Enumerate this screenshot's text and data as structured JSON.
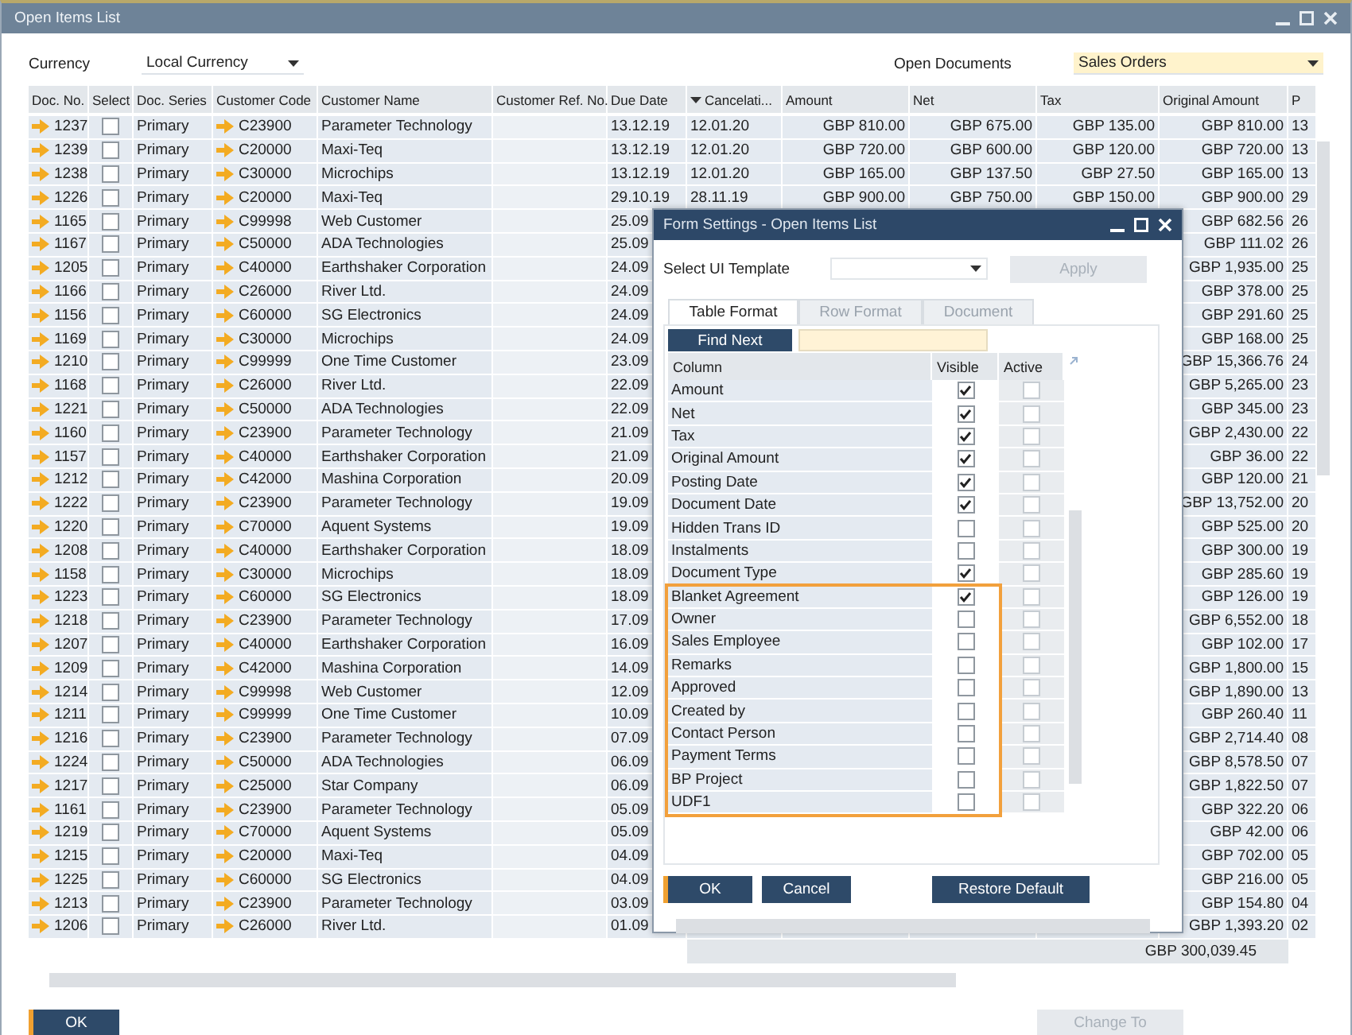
{
  "window": {
    "title": "Open Items List"
  },
  "filters": [
    {
      "label": "Currency",
      "value": "Local Currency",
      "highlighted": false
    },
    {
      "label": "Open Documents",
      "value": "Sales Orders",
      "highlighted": true
    }
  ],
  "table": {
    "columns": [
      {
        "label": "Doc. No.",
        "sorted": false
      },
      {
        "label": "Select",
        "sorted": false
      },
      {
        "label": "Doc. Series",
        "sorted": false
      },
      {
        "label": "Customer Code",
        "sorted": false
      },
      {
        "label": "Customer Name",
        "sorted": false
      },
      {
        "label": "Customer Ref. No.",
        "sorted": false
      },
      {
        "label": "Due Date",
        "sorted": false
      },
      {
        "label": "Cancelati...",
        "sorted": true
      },
      {
        "label": "Amount",
        "sorted": false
      },
      {
        "label": "Net",
        "sorted": false
      },
      {
        "label": "Tax",
        "sorted": false
      },
      {
        "label": "Original Amount",
        "sorted": false
      },
      {
        "label": "P",
        "sorted": false
      }
    ],
    "rows": [
      {
        "doc_no": "1237",
        "checked": false,
        "series": "Primary",
        "code": "C23900",
        "name": "Parameter Technology",
        "due_date": "13.12.19",
        "cancelation": "12.01.20",
        "amount": "GBP 810.00",
        "net": "GBP 675.00",
        "tax": "GBP 135.00",
        "original_amount": "GBP 810.00",
        "column_13": "13"
      },
      {
        "doc_no": "1239",
        "checked": false,
        "series": "Primary",
        "code": "C20000",
        "name": "Maxi-Teq",
        "due_date": "13.12.19",
        "cancelation": "12.01.20",
        "amount": "GBP 720.00",
        "net": "GBP 600.00",
        "tax": "GBP 120.00",
        "original_amount": "GBP 720.00",
        "column_13": "13"
      },
      {
        "doc_no": "1238",
        "checked": false,
        "series": "Primary",
        "code": "C30000",
        "name": "Microchips",
        "due_date": "13.12.19",
        "cancelation": "12.01.20",
        "amount": "GBP 165.00",
        "net": "GBP 137.50",
        "tax": "GBP 27.50",
        "original_amount": "GBP 165.00",
        "column_13": "13"
      },
      {
        "doc_no": "1226",
        "checked": false,
        "series": "Primary",
        "code": "C20000",
        "name": "Maxi-Teq",
        "due_date": "29.10.19",
        "cancelation": "28.11.19",
        "amount": "GBP 900.00",
        "net": "GBP 750.00",
        "tax": "GBP 150.00",
        "original_amount": "GBP 900.00",
        "column_13": "29"
      },
      {
        "doc_no": "1165",
        "checked": false,
        "series": "Primary",
        "code": "C99998",
        "name": "Web Customer",
        "due_date": "25.09",
        "original_amount": "GBP 682.56",
        "column_13": "26"
      },
      {
        "doc_no": "1167",
        "checked": false,
        "series": "Primary",
        "code": "C50000",
        "name": "ADA Technologies",
        "due_date": "25.09",
        "original_amount": "GBP 111.02",
        "column_13": "26"
      },
      {
        "doc_no": "1205",
        "checked": false,
        "series": "Primary",
        "code": "C40000",
        "name": "Earthshaker Corporation",
        "due_date": "24.09",
        "original_amount": "GBP 1,935.00",
        "column_13": "25"
      },
      {
        "doc_no": "1166",
        "checked": false,
        "series": "Primary",
        "code": "C26000",
        "name": "River Ltd.",
        "due_date": "24.09",
        "original_amount": "GBP 378.00",
        "column_13": "25"
      },
      {
        "doc_no": "1156",
        "checked": false,
        "series": "Primary",
        "code": "C60000",
        "name": "SG Electronics",
        "due_date": "24.09",
        "original_amount": "GBP 291.60",
        "column_13": "25"
      },
      {
        "doc_no": "1169",
        "checked": false,
        "series": "Primary",
        "code": "C30000",
        "name": "Microchips",
        "due_date": "24.09",
        "original_amount": "GBP 168.00",
        "column_13": "25"
      },
      {
        "doc_no": "1210",
        "checked": false,
        "series": "Primary",
        "code": "C99999",
        "name": "One Time Customer",
        "due_date": "23.09",
        "original_amount": "GBP 15,366.76",
        "column_13": "24"
      },
      {
        "doc_no": "1168",
        "checked": false,
        "series": "Primary",
        "code": "C26000",
        "name": "River Ltd.",
        "due_date": "22.09",
        "original_amount": "GBP 5,265.00",
        "column_13": "23"
      },
      {
        "doc_no": "1221",
        "checked": false,
        "series": "Primary",
        "code": "C50000",
        "name": "ADA Technologies",
        "due_date": "22.09",
        "original_amount": "GBP 345.00",
        "column_13": "23"
      },
      {
        "doc_no": "1160",
        "checked": false,
        "series": "Primary",
        "code": "C23900",
        "name": "Parameter Technology",
        "due_date": "21.09",
        "original_amount": "GBP 2,430.00",
        "column_13": "22"
      },
      {
        "doc_no": "1157",
        "checked": false,
        "series": "Primary",
        "code": "C40000",
        "name": "Earthshaker Corporation",
        "due_date": "21.09",
        "original_amount": "GBP 36.00",
        "column_13": "22"
      },
      {
        "doc_no": "1212",
        "checked": false,
        "series": "Primary",
        "code": "C42000",
        "name": "Mashina Corporation",
        "due_date": "20.09",
        "original_amount": "GBP 120.00",
        "column_13": "21"
      },
      {
        "doc_no": "1222",
        "checked": false,
        "series": "Primary",
        "code": "C23900",
        "name": "Parameter Technology",
        "due_date": "19.09",
        "original_amount": "GBP 13,752.00",
        "column_13": "20"
      },
      {
        "doc_no": "1220",
        "checked": false,
        "series": "Primary",
        "code": "C70000",
        "name": "Aquent Systems",
        "due_date": "19.09",
        "original_amount": "GBP 525.00",
        "column_13": "20"
      },
      {
        "doc_no": "1208",
        "checked": false,
        "series": "Primary",
        "code": "C40000",
        "name": "Earthshaker Corporation",
        "due_date": "18.09",
        "original_amount": "GBP 300.00",
        "column_13": "19"
      },
      {
        "doc_no": "1158",
        "checked": false,
        "series": "Primary",
        "code": "C30000",
        "name": "Microchips",
        "due_date": "18.09",
        "original_amount": "GBP 285.60",
        "column_13": "19"
      },
      {
        "doc_no": "1223",
        "checked": false,
        "series": "Primary",
        "code": "C60000",
        "name": "SG Electronics",
        "due_date": "18.09",
        "original_amount": "GBP 126.00",
        "column_13": "19"
      },
      {
        "doc_no": "1218",
        "checked": false,
        "series": "Primary",
        "code": "C23900",
        "name": "Parameter Technology",
        "due_date": "17.09",
        "original_amount": "GBP 6,552.00",
        "column_13": "18"
      },
      {
        "doc_no": "1207",
        "checked": false,
        "series": "Primary",
        "code": "C40000",
        "name": "Earthshaker Corporation",
        "due_date": "16.09",
        "original_amount": "GBP 102.00",
        "column_13": "17"
      },
      {
        "doc_no": "1209",
        "checked": false,
        "series": "Primary",
        "code": "C42000",
        "name": "Mashina Corporation",
        "due_date": "14.09",
        "original_amount": "GBP 1,800.00",
        "column_13": "15"
      },
      {
        "doc_no": "1214",
        "checked": false,
        "series": "Primary",
        "code": "C99998",
        "name": "Web Customer",
        "due_date": "12.09",
        "original_amount": "GBP 1,890.00",
        "column_13": "13"
      },
      {
        "doc_no": "1211",
        "checked": false,
        "series": "Primary",
        "code": "C99999",
        "name": "One Time Customer",
        "due_date": "10.09",
        "original_amount": "GBP 260.40",
        "column_13": "11"
      },
      {
        "doc_no": "1216",
        "checked": false,
        "series": "Primary",
        "code": "C23900",
        "name": "Parameter Technology",
        "due_date": "07.09",
        "original_amount": "GBP 2,714.40",
        "column_13": "08"
      },
      {
        "doc_no": "1224",
        "checked": false,
        "series": "Primary",
        "code": "C50000",
        "name": "ADA Technologies",
        "due_date": "06.09",
        "original_amount": "GBP 8,578.50",
        "column_13": "07"
      },
      {
        "doc_no": "1217",
        "checked": false,
        "series": "Primary",
        "code": "C25000",
        "name": "Star Company",
        "due_date": "06.09",
        "original_amount": "GBP 1,822.50",
        "column_13": "07"
      },
      {
        "doc_no": "1161",
        "checked": false,
        "series": "Primary",
        "code": "C23900",
        "name": "Parameter Technology",
        "due_date": "05.09",
        "original_amount": "GBP 322.20",
        "column_13": "06"
      },
      {
        "doc_no": "1219",
        "checked": false,
        "series": "Primary",
        "code": "C70000",
        "name": "Aquent Systems",
        "due_date": "05.09",
        "original_amount": "GBP 42.00",
        "column_13": "06"
      },
      {
        "doc_no": "1215",
        "checked": false,
        "series": "Primary",
        "code": "C20000",
        "name": "Maxi-Teq",
        "due_date": "04.09",
        "original_amount": "GBP 702.00",
        "column_13": "05"
      },
      {
        "doc_no": "1225",
        "checked": false,
        "series": "Primary",
        "code": "C60000",
        "name": "SG Electronics",
        "due_date": "04.09",
        "original_amount": "GBP 216.00",
        "column_13": "05"
      },
      {
        "doc_no": "1213",
        "checked": false,
        "series": "Primary",
        "code": "C23900",
        "name": "Parameter Technology",
        "due_date": "03.09",
        "original_amount": "GBP 154.80",
        "column_13": "04"
      },
      {
        "doc_no": "1206",
        "checked": false,
        "series": "Primary",
        "code": "C26000",
        "name": "River Ltd.",
        "due_date": "01.09",
        "original_amount": "GBP 1,393.20",
        "column_13": "02"
      }
    ],
    "total": "GBP 300,039.45"
  },
  "buttons": [
    {
      "label": "OK",
      "disabled": false
    },
    {
      "label": "Change To",
      "disabled": true
    }
  ],
  "dialog": {
    "title": "Form Settings - Open Items List",
    "template_label": "Select UI Template",
    "apply": {
      "label": "Apply",
      "disabled": true
    },
    "tabs": [
      {
        "label": "Table Format",
        "selected": true
      },
      {
        "label": "Row Format",
        "selected": false
      },
      {
        "label": "Document",
        "selected": false
      }
    ],
    "find_next": "Find Next",
    "grid_columns": [
      "Column",
      "Visible",
      "Active"
    ],
    "row_groups": [
      {
        "highlighted": false,
        "rows": [
          {
            "label": "Amount",
            "visible": true,
            "active": false
          },
          {
            "label": "Net",
            "visible": true,
            "active": false
          },
          {
            "label": "Tax",
            "visible": true,
            "active": false
          },
          {
            "label": "Original Amount",
            "visible": true,
            "active": false
          },
          {
            "label": "Posting Date",
            "visible": true,
            "active": false
          },
          {
            "label": "Document Date",
            "visible": true,
            "active": false
          },
          {
            "label": "Hidden Trans ID",
            "visible": false,
            "active": false
          },
          {
            "label": "Instalments",
            "visible": false,
            "active": false
          },
          {
            "label": "Document Type",
            "visible": true,
            "active": false
          }
        ]
      },
      {
        "highlighted": true,
        "rows": [
          {
            "label": "Blanket Agreement",
            "visible": true,
            "active": false
          },
          {
            "label": "Owner",
            "visible": false,
            "active": false
          },
          {
            "label": "Sales Employee",
            "visible": false,
            "active": false
          },
          {
            "label": "Remarks",
            "visible": false,
            "active": false
          },
          {
            "label": "Approved",
            "visible": false,
            "active": false
          },
          {
            "label": "Created by",
            "visible": false,
            "active": false
          },
          {
            "label": "Contact Person",
            "visible": false,
            "active": false
          },
          {
            "label": "Payment Terms",
            "visible": false,
            "active": false
          },
          {
            "label": "BP Project",
            "visible": false,
            "active": false
          },
          {
            "label": "UDF1",
            "visible": false,
            "active": false
          }
        ]
      }
    ],
    "buttons": [
      {
        "label": "OK",
        "primary": true
      },
      {
        "label": "Cancel",
        "primary": false
      },
      {
        "label": "Restore Default",
        "primary": false
      }
    ]
  }
}
